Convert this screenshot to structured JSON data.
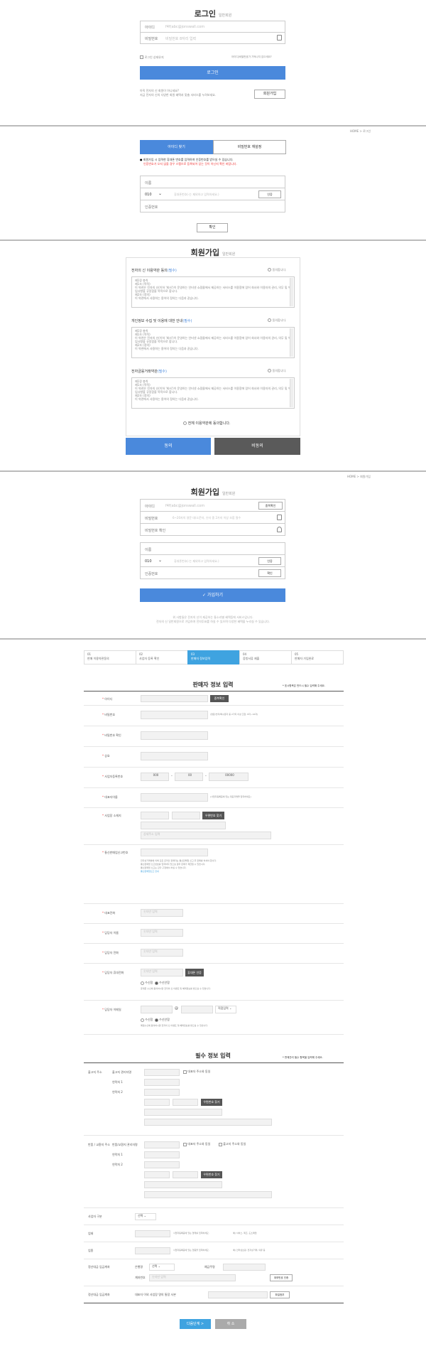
{
  "login": {
    "title": "로그인",
    "subtitle": "일반회원",
    "id_label": "아이디",
    "id_placeholder": "f4f(abc@jonswall.com",
    "pw_label": "비밀번호",
    "pw_placeholder": "비밀번호 8자리 입력",
    "keep_login": "로그인 상태유지",
    "find_link": "아이디/비밀번호가 기억나지 않으세요?",
    "submit": "로그인",
    "notice1": "아직 전자의 신 회원이 아니세요?",
    "notice2": "지금 전자의 신의 다양한 회원 혜택과 맞춤 서비스를 누려보세요.",
    "join_btn": "회원가입"
  },
  "find": {
    "breadcrumb_home": "HOME",
    "breadcrumb_sep": ">",
    "breadcrumb_current": "로그인",
    "tab_id": "아이디 찾기",
    "tab_pw": "비밀번호 재설정",
    "notice": "회원가입 시 입력한 휴대폰 번호를 입력하여 인증번호를 받으실 수 있습니다.",
    "notice2": "인증번호가 오지 않을 경우 스팸으로 등록되어 있는 것이 아닌지 확인 바랍니다.",
    "name_label": "이름",
    "phone_prefix": "010",
    "phone_placeholder": "휴대폰번호(-는 제외하고 입력하세요.)",
    "verify_btn": "인증",
    "code_label": "인증번호",
    "confirm_btn": "확인"
  },
  "terms": {
    "title": "회원가입",
    "subtitle": "일반회원",
    "agree_each": "동의합니다.",
    "items": [
      {
        "title": "전자의 신 이용약관 동의",
        "req": "(필수)",
        "body": [
          "제1장 총칙",
          "제1조 (목적)",
          "이 약관은 전자의 신(이하 '회사')이 운영하는 인터넷 쇼핑몰에서 제공하는 서비스를 이용함에 있어 회사와 이용자의 권리, 의무 및 책임사항을 규정함을 목적으로 합니다.",
          "제2조 (정의)",
          "이 약관에서 사용하는 용어의 정의는 다음과 같습니다."
        ]
      },
      {
        "title": "개인정보 수집 및 이용에 대한 안내",
        "req": "(필수)",
        "body": [
          "제1장 총칙",
          "제1조 (목적)",
          "이 약관은 전자의 신(이하 '회사')이 운영하는 인터넷 쇼핑몰에서 제공하는 서비스를 이용함에 있어 회사와 이용자의 권리, 의무 및 책임사항을 규정함을 목적으로 합니다.",
          "제2조 (정의)",
          "이 약관에서 사용하는 용어의 정의는 다음과 같습니다."
        ]
      },
      {
        "title": "전자금융거래약관",
        "req": "(필수)",
        "body": [
          "제1장 총칙",
          "제1조 (목적)",
          "이 약관은 전자의 신(이하 '회사')이 운영하는 인터넷 쇼핑몰에서 제공하는 서비스를 이용함에 있어 회사와 이용자의 권리, 의무 및 책임사항을 규정함을 목적으로 합니다.",
          "제2조 (정의)",
          "이 약관에서 사용하는 용어의 정의는 다음과 같습니다."
        ]
      }
    ],
    "agree_all": "전체 이용약관에 동의합니다.",
    "agree_btn": "동의",
    "disagree_btn": "비동의"
  },
  "join": {
    "breadcrumb_home": "HOME",
    "breadcrumb_sep": ">",
    "breadcrumb_current": "회원가입",
    "title": "회원가입",
    "subtitle": "일반회원",
    "id_label": "아이디",
    "id_placeholder": "f4f(abc@jonswall.com",
    "dup_btn": "중복확인",
    "pw_label": "비밀번호",
    "pw_placeholder": "6~20자의 영문 대/소문자, 숫자 중 2가지 이상 조합 필수",
    "pw_confirm_label": "비밀번호 확인",
    "name_label": "이름",
    "phone_prefix": "010",
    "phone_placeholder": "휴대폰번호(-는 제외하고 입력하세요.)",
    "verify_btn": "인증",
    "code_label": "인증번호",
    "confirm_btn": "확인",
    "submit": "가입하기",
    "footer1": "위 사항들은 전자의 신이 제공하는 통소리별 혜택등에 서비스입니다.",
    "footer2": "전자의 신 일반회원으로 가입하여 전자투표를 하실 수 있으며 다양한 혜택을 누리실 수 있습니다."
  },
  "seller": {
    "steps": [
      {
        "no": "01",
        "label": "판매 이용약관동의"
      },
      {
        "no": "02",
        "label": "사업자 등록 확인"
      },
      {
        "no": "03",
        "label": "판매자 정보입력"
      },
      {
        "no": "04",
        "label": "증빙서류 제출"
      },
      {
        "no": "05",
        "label": "판매자 가입완료"
      }
    ],
    "title": "판매자 정보 입력",
    "required_note": "* 표시항목은 반드시 필수 입력해 주세요.",
    "fields": [
      {
        "label": "아이디",
        "btn": "중복확인"
      },
      {
        "label": "비밀번호",
        "hint": "(영문/숫자/특수문자 중 2가지 이상 조합, 8자~16자)"
      },
      {
        "label": "비밀번호 확인"
      },
      {
        "label": "상호"
      },
      {
        "label": "사업자등록번호",
        "p1": "000",
        "p2": "00",
        "p3": "00000"
      },
      {
        "label": "대표자이름",
        "hint": "(사업자등록증에 있는 대표자명을 입력하세요)"
      },
      {
        "label": "사업장 소재지",
        "btn": "우편번호 찾기",
        "placeholder": "상세주소 입력"
      },
      {
        "label": "통신판매업신고번호"
      },
      {
        "label": "대표전화",
        "placeholder": "숫자만 입력"
      },
      {
        "label": "담당자 이름",
        "placeholder": "숫자만 입력"
      },
      {
        "label": "담당자 전화",
        "placeholder": "숫자만 입력"
      },
      {
        "label": "담당자 휴대전화",
        "placeholder": "숫자만 입력",
        "btn": "휴대폰 인증"
      },
      {
        "label": "담당자 이메일",
        "domain": "직접입력"
      }
    ],
    "ecommerce_notes": [
      "전자상거래법에 의해 모든 온라인 판매자는 통신판매업 신고 후 판매를 하셔야 합니다.",
      "통신판매업 신고번호를 입력하지 않으실 경우 판매가 제한될 수 있습니다.",
      "통신판매업 신고는 관할 구청에서 하실 수 있습니다."
    ],
    "ecommerce_link": "통신판매업신고 안내",
    "sms_yes": "수신함",
    "sms_no": "수신안함",
    "sms_note": "휴대폰 수신에 동의하시면 전자의 신 이벤트 및 혜택정보를 받으실 수 있습니다.",
    "email_yes": "수신함",
    "email_no": "수신안함",
    "email_note": "메일수신에 동의하시면 전자의 신 이벤트 및 혜택정보를 받으실 수 있습니다.",
    "at": "@",
    "req_title": "필수 정보 입력",
    "req_note": "* 판매관리 필수 항목을 입력해 주세요.",
    "ship_label": "출고지 주소",
    "ship_name": "출고지 관리자명",
    "ship_phone1": "연락처 1",
    "ship_phone2": "연락처 2",
    "same_addr": "대표자 주소와 동일",
    "zip_btn": "우편번호 찾기",
    "ret_label": "반품 / 교환지 주소",
    "ret_name": "반품/교환지 관리자명",
    "ret_same1": "대표자 주소와 동일",
    "ret_same2": "출고지 주소와 동일",
    "biz_type_label": "사업자 구분",
    "biz_type_val": "선택",
    "cond_label": "업태",
    "cond_hint": "사업자등록증에 있는 업태를 입력하세요.",
    "cond_ex": "예) 서비스, 제조, 도소매업",
    "item_label": "업종",
    "item_hint": "사업자등록증에 있는 업종을 입력하세요.",
    "item_ex": "예) 인터넷쇼핑, 전자상거래, 의류 등",
    "account_label": "정산대금 입금계좌",
    "bank_label": "은행명",
    "bank_val": "선택",
    "holder_label": "예금주명",
    "acct_no_label": "계좌번호",
    "acct_btn": "계좌번호 인증",
    "tax_label": "정산대금 입금계좌",
    "tax_text": "대표자 이외 사업장 명의 통장 사본",
    "tax_btn": "파일첨부",
    "next_btn": "다음단계 >",
    "cancel_btn": "취 소"
  }
}
